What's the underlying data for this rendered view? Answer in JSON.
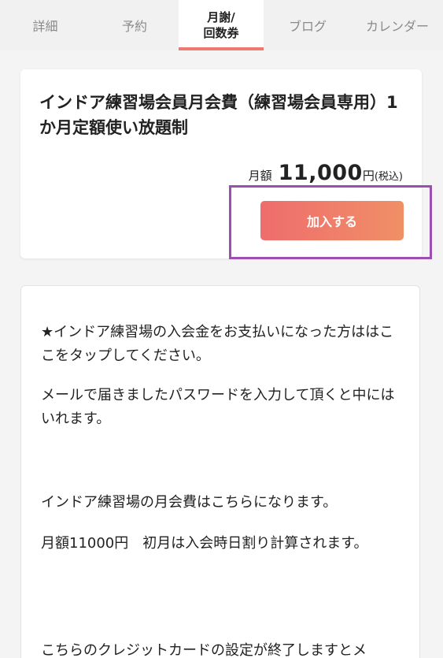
{
  "tabs": [
    {
      "label": "詳細"
    },
    {
      "label": "予約"
    },
    {
      "label_line1": "月謝/",
      "label_line2": "回数券",
      "active": true
    },
    {
      "label": "ブログ"
    },
    {
      "label": "カレンダー"
    }
  ],
  "plan": {
    "title": "インドア練習場会員月会費（練習場会員専用）1か月定額使い放題制",
    "price_prefix": "月額",
    "price_amount": "11,000",
    "price_unit": "円",
    "price_tax": "(税込)",
    "join_label": "加入する"
  },
  "description": {
    "p1": "★インドア練習場の入会金をお支払いになった方ははここをタップしてください。",
    "p2": "メールで届きましたパスワードを入力して頂くと中にはいれます。",
    "p3": "インドア練習場の月会費はこちらになります。",
    "p4": "月額11000円　初月は入会時日割り計算されます。",
    "p5": "こちらのクレジットカードの設定が終了しますとメ"
  },
  "colors": {
    "accent": "#ee7a6f",
    "button_start": "#ee6d6d",
    "button_end": "#f08f66",
    "highlight": "#9b4fb0"
  }
}
